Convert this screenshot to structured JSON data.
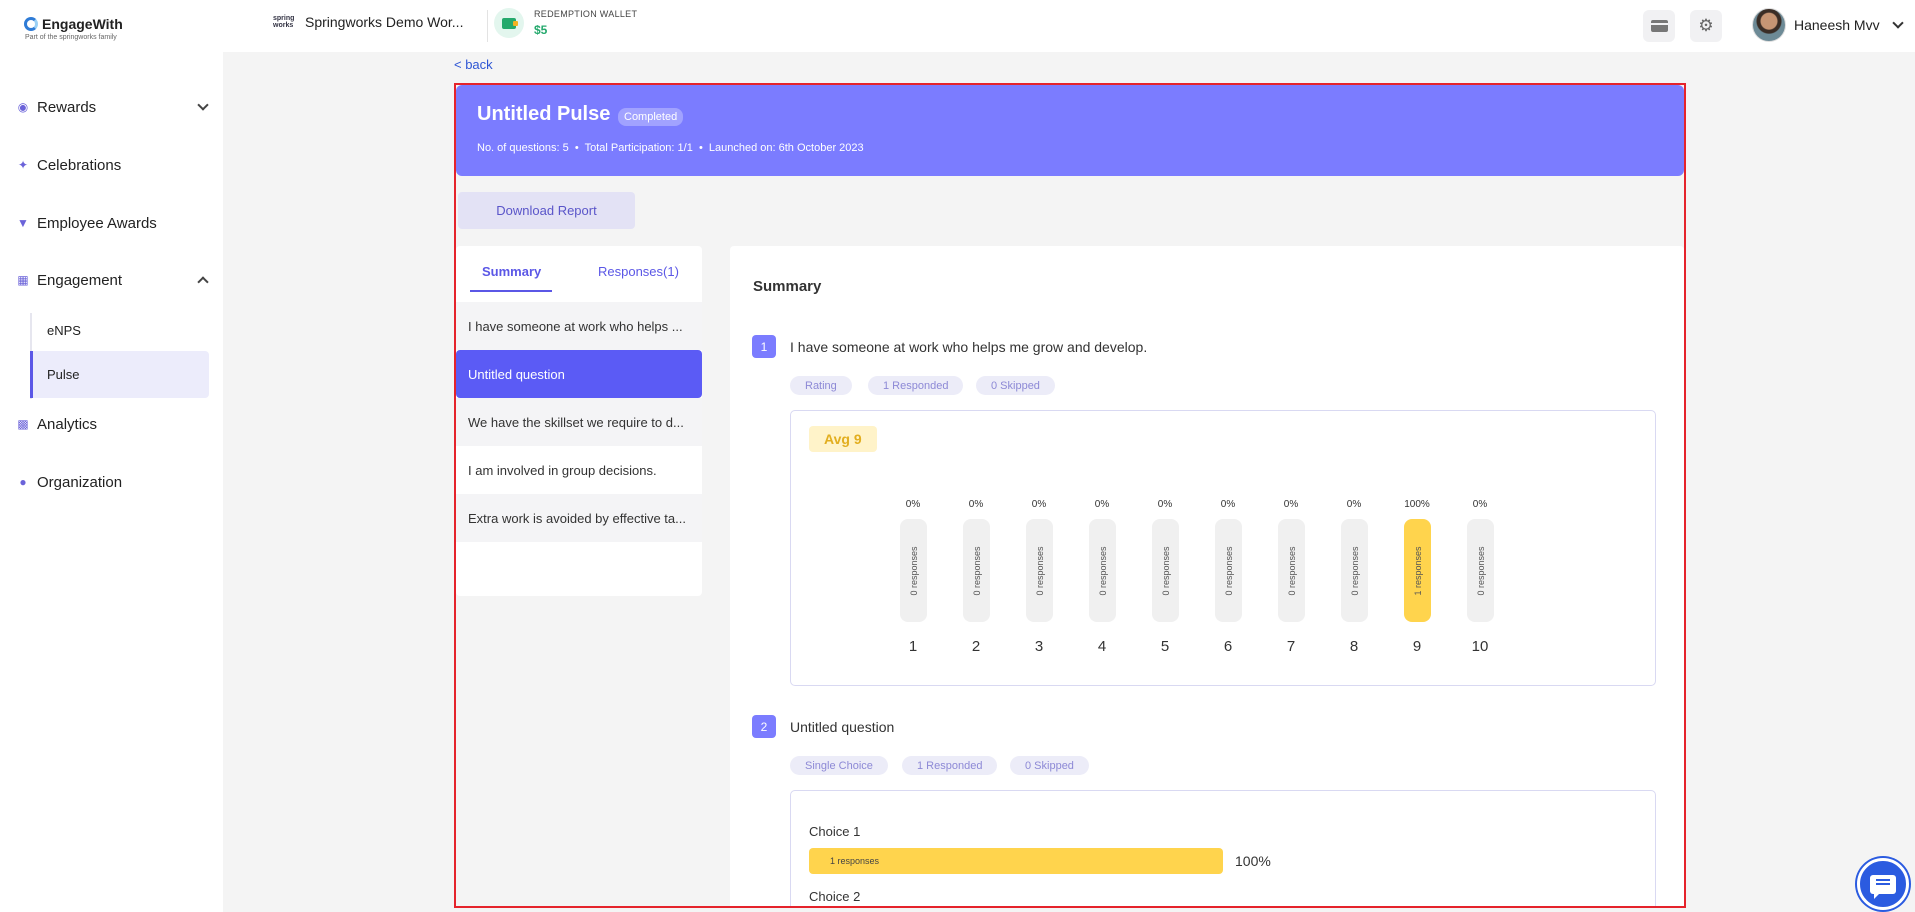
{
  "brand": {
    "name": "EngageWith",
    "tagline": "Part of the springworks family"
  },
  "workspace": {
    "logo_text": "spring works",
    "name": "Springworks Demo Wor..."
  },
  "wallet": {
    "label": "REDEMPTION WALLET",
    "value": "$5"
  },
  "user": {
    "name": "Haneesh Mvv"
  },
  "sidebar": {
    "items": [
      {
        "label": "Rewards",
        "icon": "medal-icon"
      },
      {
        "label": "Celebrations",
        "icon": "party-popper-icon"
      },
      {
        "label": "Employee Awards",
        "icon": "trophy-icon"
      },
      {
        "label": "Engagement",
        "icon": "engagement-icon"
      },
      {
        "label": "Analytics",
        "icon": "bar-chart-icon"
      },
      {
        "label": "Organization",
        "icon": "people-icon"
      }
    ],
    "sub_items": [
      {
        "label": "eNPS"
      },
      {
        "label": "Pulse"
      }
    ]
  },
  "back_label": "< back",
  "pulse": {
    "title": "Untitled Pulse",
    "status": "Completed",
    "meta": "No. of questions: 5  •  Total Participation: 1/1  •  Launched on: 6th October 2023"
  },
  "download_label": "Download Report",
  "tabs": {
    "summary": "Summary",
    "responses": "Responses(1)"
  },
  "question_list": [
    "I have someone at work who helps ...",
    "Untitled question",
    "We have the skillset we require to d...",
    "I am involved in group decisions.",
    "Extra work is avoided by effective ta..."
  ],
  "summary": {
    "title": "Summary",
    "questions": [
      {
        "num": "1",
        "text": "I have someone at work who helps me grow and develop.",
        "type": "Rating",
        "responded": "1 Responded",
        "skipped": "0 Skipped",
        "avg": "Avg 9",
        "ratings": [
          {
            "label": "1",
            "pct": "0%",
            "responses": "0 responses"
          },
          {
            "label": "2",
            "pct": "0%",
            "responses": "0 responses"
          },
          {
            "label": "3",
            "pct": "0%",
            "responses": "0 responses"
          },
          {
            "label": "4",
            "pct": "0%",
            "responses": "0 responses"
          },
          {
            "label": "5",
            "pct": "0%",
            "responses": "0 responses"
          },
          {
            "label": "6",
            "pct": "0%",
            "responses": "0 responses"
          },
          {
            "label": "7",
            "pct": "0%",
            "responses": "0 responses"
          },
          {
            "label": "8",
            "pct": "0%",
            "responses": "0 responses"
          },
          {
            "label": "9",
            "pct": "100%",
            "responses": "1 responses"
          },
          {
            "label": "10",
            "pct": "0%",
            "responses": "0 responses"
          }
        ]
      },
      {
        "num": "2",
        "text": "Untitled question",
        "type": "Single Choice",
        "responded": "1 Responded",
        "skipped": "0 Skipped",
        "choices": [
          {
            "label": "Choice 1",
            "bar_text": "1 responses",
            "pct": "100%",
            "fraction": 1.0
          },
          {
            "label": "Choice 2"
          }
        ]
      }
    ]
  },
  "colors": {
    "accent": "#7b7cff",
    "primary": "#5b5bf5",
    "highlight": "#ffd44d",
    "wallet": "#25a96d",
    "frame": "#e5232b"
  }
}
